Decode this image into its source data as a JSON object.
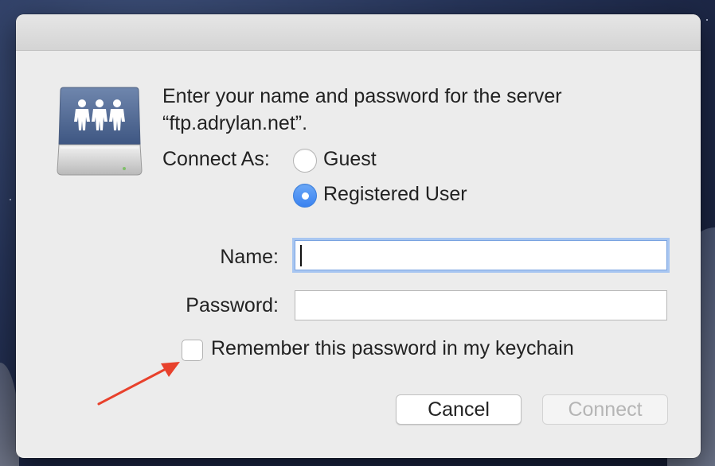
{
  "dialog": {
    "server_icon": "shared-server-icon",
    "prompt_line1": "Enter your name and password for the server",
    "prompt_line2": "“ftp.adrylan.net”.",
    "connect_as_label": "Connect As:",
    "options": [
      {
        "label": "Guest",
        "selected": false
      },
      {
        "label": "Registered User",
        "selected": true
      }
    ],
    "name_label": "Name:",
    "name_value": "",
    "password_label": "Password:",
    "password_value": "",
    "remember_label": "Remember this password in my keychain",
    "remember_checked": false,
    "cancel_label": "Cancel",
    "connect_label": "Connect",
    "connect_enabled": false
  },
  "annotation": {
    "arrow_color": "#e8412c"
  },
  "colors": {
    "accent": "#3a82f0",
    "focus_ring": "#a8c6f1"
  }
}
